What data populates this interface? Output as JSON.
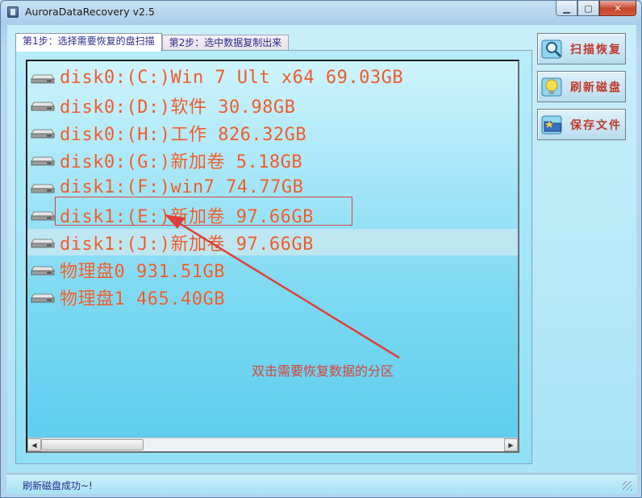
{
  "window": {
    "title": "AuroraDataRecovery v2.5",
    "minimize": "▁",
    "maximize": "▢",
    "close": "✕"
  },
  "tabs": [
    {
      "label": "第1步：选择需要恢复的盘扫描",
      "active": true
    },
    {
      "label": "第2步：选中数据复制出来",
      "active": false
    }
  ],
  "disks": [
    {
      "label": "disk0:(C:)Win 7 Ult x64 69.03GB"
    },
    {
      "label": "disk0:(D:)软件 30.98GB"
    },
    {
      "label": "disk0:(H:)工作 826.32GB"
    },
    {
      "label": "disk0:(G:)新加卷 5.18GB"
    },
    {
      "label": "disk1:(F:)win7 74.77GB"
    },
    {
      "label": "disk1:(E:)新加卷 97.66GB"
    },
    {
      "label": "disk1:(J:)新加卷 97.66GB"
    },
    {
      "label": "物理盘0 931.51GB"
    },
    {
      "label": "物理盘1 465.40GB"
    }
  ],
  "selected_disk_index": 6,
  "annotation": {
    "text": "双击需要恢复数据的分区",
    "color": "#d94237"
  },
  "buttons": {
    "scan": "扫描恢复",
    "refresh": "刷新磁盘",
    "save": "保存文件"
  },
  "scrollbar": {
    "left_arrow": "◀",
    "right_arrow": "▶"
  },
  "status": {
    "text": "刷新磁盘成功~!"
  },
  "colors": {
    "disk_text": "#ea5c2a",
    "button_text": "#c03a2b",
    "tab_text": "#2b2b8f"
  },
  "icons": {
    "app": "app-icon",
    "disk": "hard-disk-icon",
    "scan": "magnifier-icon",
    "refresh": "lightbulb-icon",
    "save": "folder-star-icon"
  }
}
